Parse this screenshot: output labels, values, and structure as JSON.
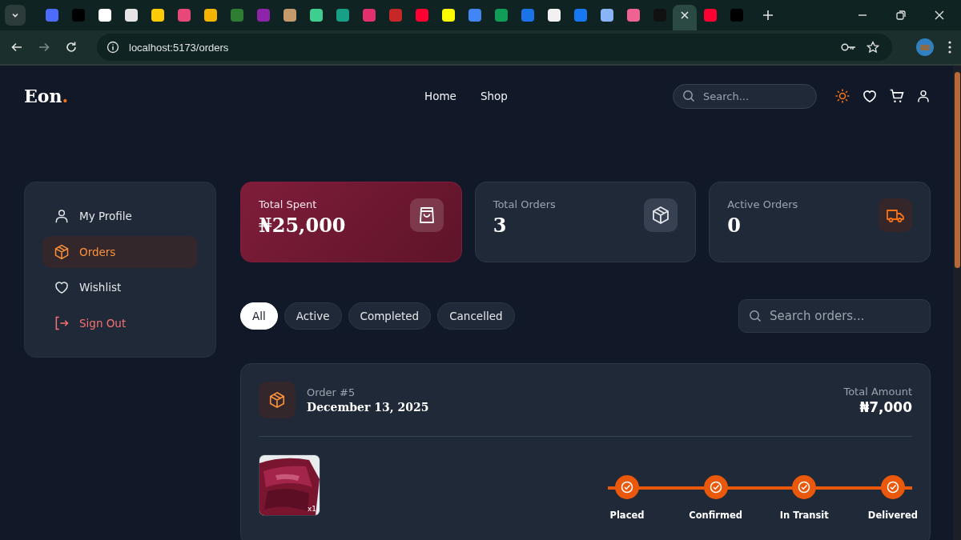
{
  "browser": {
    "tabs": [
      {
        "color": "#4d6bfe",
        "selected": false
      },
      {
        "color": "#000000",
        "selected": false
      },
      {
        "color": "#ffffff",
        "selected": false
      },
      {
        "color": "#e5e5e5",
        "selected": false
      },
      {
        "color": "#ffcb05",
        "selected": false
      },
      {
        "color": "#e8477a",
        "selected": false
      },
      {
        "color": "#f4b400",
        "selected": false
      },
      {
        "color": "#2e7d32",
        "selected": false
      },
      {
        "color": "#8e24aa",
        "selected": false
      },
      {
        "color": "#c59b6d",
        "selected": false
      },
      {
        "color": "#3ecf8e",
        "selected": false
      },
      {
        "color": "#17a086",
        "selected": false
      },
      {
        "color": "#e1306c",
        "selected": false
      },
      {
        "color": "#c62828",
        "selected": false
      },
      {
        "color": "#ff0033",
        "selected": false
      },
      {
        "color": "#fffc00",
        "selected": false
      },
      {
        "color": "#4285f4",
        "selected": false
      },
      {
        "color": "#0f9d58",
        "selected": false
      },
      {
        "color": "#1a73e8",
        "selected": false
      },
      {
        "color": "#f1f1f1",
        "selected": false
      },
      {
        "color": "#1877f2",
        "selected": false
      },
      {
        "color": "#8ab4f8",
        "selected": false
      },
      {
        "color": "#f06292",
        "selected": false
      },
      {
        "color": "#111111",
        "selected": false
      },
      {
        "color": "#2c4a44",
        "selected": true
      },
      {
        "color": "#ff0033",
        "selected": false
      },
      {
        "color": "#000000",
        "selected": false
      }
    ],
    "url": "localhost:5173/orders"
  },
  "header": {
    "logo": "Eon",
    "logo_dot": ".",
    "nav": [
      {
        "label": "Home"
      },
      {
        "label": "Shop"
      }
    ],
    "search": {
      "placeholder": "Search..."
    }
  },
  "sidebar": {
    "items": [
      {
        "label": "My Profile",
        "kind": "profile",
        "selected": false
      },
      {
        "label": "Orders",
        "kind": "orders",
        "selected": true
      },
      {
        "label": "Wishlist",
        "kind": "wishlist",
        "selected": false
      },
      {
        "label": "Sign Out",
        "kind": "signout",
        "selected": false
      }
    ]
  },
  "stats": [
    {
      "label": "Total Spent",
      "value": "₦25,000",
      "kind": "spent"
    },
    {
      "label": "Total Orders",
      "value": "3",
      "kind": "orders"
    },
    {
      "label": "Active Orders",
      "value": "0",
      "kind": "active"
    }
  ],
  "filters": [
    {
      "label": "All",
      "selected": true
    },
    {
      "label": "Active",
      "selected": false
    },
    {
      "label": "Completed",
      "selected": false
    },
    {
      "label": "Cancelled",
      "selected": false
    }
  ],
  "order_search": {
    "placeholder": "Search orders..."
  },
  "order": {
    "number": "Order #5",
    "date": "December 13, 2025",
    "total_label": "Total Amount",
    "total": "₦7,000",
    "items": [
      {
        "kind": "picture",
        "quantity": "x1"
      }
    ],
    "steps": [
      {
        "label": "Placed",
        "done": true
      },
      {
        "label": "Confirmed",
        "done": true
      },
      {
        "label": "In Transit",
        "done": true
      },
      {
        "label": "Delivered",
        "done": true
      }
    ]
  }
}
